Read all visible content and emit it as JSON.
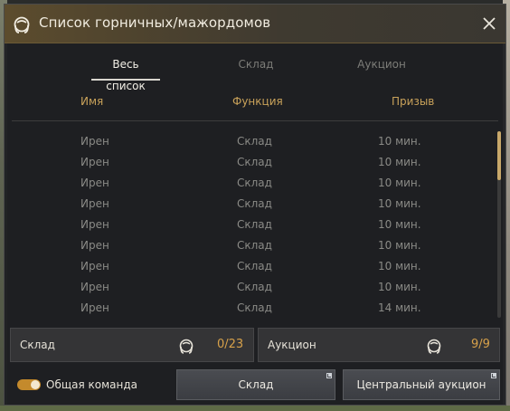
{
  "window": {
    "title": "Список горничных/мажордомов",
    "close_icon": "close-icon",
    "title_icon": "maid-icon"
  },
  "tabs": [
    {
      "label": "Весь список",
      "active": true
    },
    {
      "label": "Склад",
      "active": false
    },
    {
      "label": "Аукцион",
      "active": false
    }
  ],
  "columns": {
    "name": "Имя",
    "function": "Функция",
    "summon": "Призыв"
  },
  "rows": [
    {
      "name": "Ирен",
      "function": "Склад",
      "summon": "10 мин."
    },
    {
      "name": "Ирен",
      "function": "Склад",
      "summon": "10 мин."
    },
    {
      "name": "Ирен",
      "function": "Склад",
      "summon": "10 мин."
    },
    {
      "name": "Ирен",
      "function": "Склад",
      "summon": "10 мин."
    },
    {
      "name": "Ирен",
      "function": "Склад",
      "summon": "10 мин."
    },
    {
      "name": "Ирен",
      "function": "Склад",
      "summon": "10 мин."
    },
    {
      "name": "Ирен",
      "function": "Склад",
      "summon": "10 мин."
    },
    {
      "name": "Ирен",
      "function": "Склад",
      "summon": "10 мин."
    },
    {
      "name": "Ирен",
      "function": "Склад",
      "summon": "14 мин."
    }
  ],
  "panels": {
    "warehouse": {
      "label": "Склад",
      "count": "0/23",
      "icon": "maid-icon"
    },
    "auction": {
      "label": "Аукцион",
      "count": "9/9",
      "icon": "maid-icon"
    }
  },
  "footer": {
    "toggle_label": "Общая команда",
    "toggle_on": true,
    "warehouse_button": "Склад",
    "auction_button": "Центральный аукцион"
  },
  "colors": {
    "accent": "#d7a14a",
    "header": "#c9a25a",
    "toggle": "#c48a2c"
  }
}
